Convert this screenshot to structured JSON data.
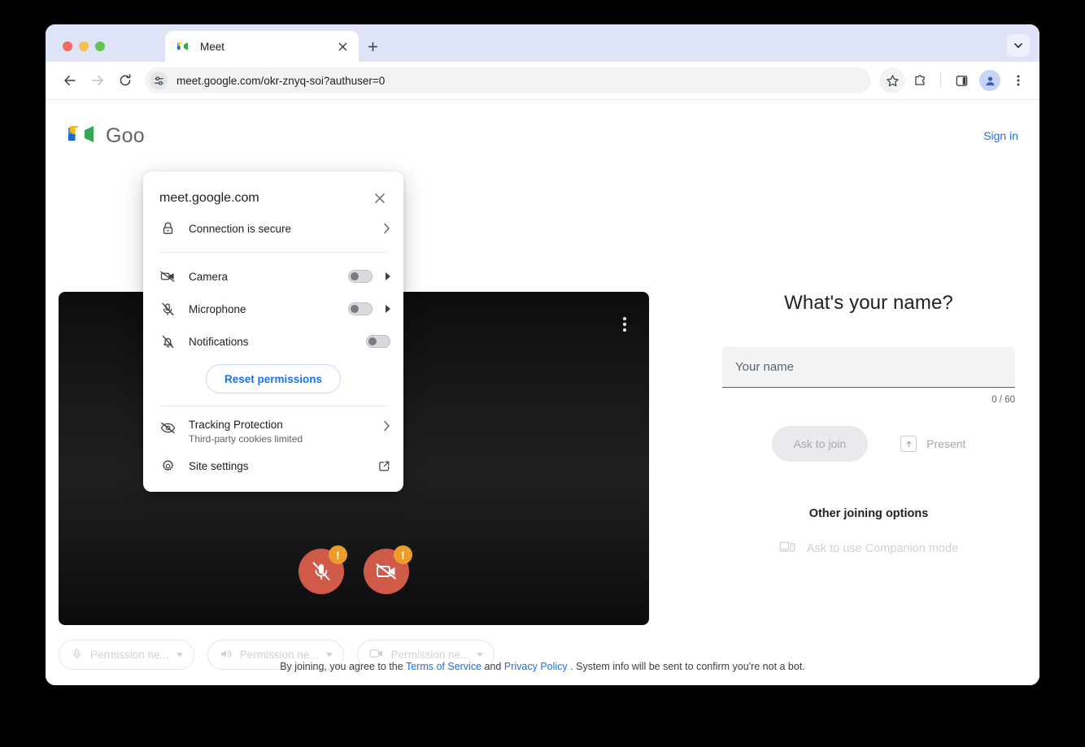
{
  "browser": {
    "tab": {
      "title": "Meet",
      "favicon": "google-meet-favicon",
      "close": "×"
    },
    "newtab_label": "+",
    "toolbar": {
      "back": "back-arrow",
      "forward": "forward-arrow",
      "reload": "reload",
      "url": "meet.google.com/okr-znyq-soi?authuser=0",
      "site_chip": "tune-icon",
      "bookmark": "star-icon",
      "extensions": "puzzle-icon",
      "side_panel": "side-panel-icon",
      "profile": "profile-avatar",
      "menu": "kebab-menu"
    }
  },
  "bubble": {
    "title": "meet.google.com",
    "close": "×",
    "connection": {
      "label": "Connection is secure",
      "icon": "lock-icon",
      "chevron": "›"
    },
    "permissions": [
      {
        "label": "Camera",
        "icon": "camera-off-icon",
        "state": "off",
        "has_submenu": true
      },
      {
        "label": "Microphone",
        "icon": "mic-off-icon",
        "state": "off",
        "has_submenu": true
      },
      {
        "label": "Notifications",
        "icon": "bell-off-icon",
        "state": "off",
        "has_submenu": false
      }
    ],
    "reset_button": "Reset permissions",
    "tracking": {
      "label": "Tracking Protection",
      "sub": "Third-party cookies limited",
      "icon": "eye-off-icon",
      "chevron": "›"
    },
    "site_settings": {
      "label": "Site settings",
      "icon": "gear-icon",
      "external": "open-in-new-icon"
    }
  },
  "meet": {
    "brand": "Goo",
    "sign_in": "Sign in",
    "preview": {
      "more": "kebab-menu-icon",
      "mic_button": {
        "icon": "mic-off-icon",
        "badge": "!"
      },
      "camera_button": {
        "icon": "camera-off-icon",
        "badge": "!"
      }
    },
    "pills": [
      {
        "icon": "mic-icon",
        "label": "Permission ne..."
      },
      {
        "icon": "speaker-icon",
        "label": "Permission ne..."
      },
      {
        "icon": "camera-icon",
        "label": "Permission ne..."
      }
    ],
    "join": {
      "heading": "What's your name?",
      "name_placeholder": "Your name",
      "name_value": "",
      "counter": "0 / 60",
      "ask_to_join": "Ask to join",
      "present": "Present",
      "present_icon": "present-arrow-icon",
      "other_title": "Other joining options",
      "companion": "Ask to use Companion mode",
      "companion_icon": "companion-device-icon"
    },
    "footer": {
      "pre": "By joining, you agree to the",
      "terms": "Terms of Service",
      "and": "and",
      "privacy": "Privacy Policy",
      "post": ". System info will be sent to confirm you're not a bot."
    }
  },
  "colors": {
    "accent_blue": "#1a73e8",
    "danger": "#cf5a47",
    "warning": "#eb9d2a",
    "tabstrip": "#dee3f7"
  }
}
